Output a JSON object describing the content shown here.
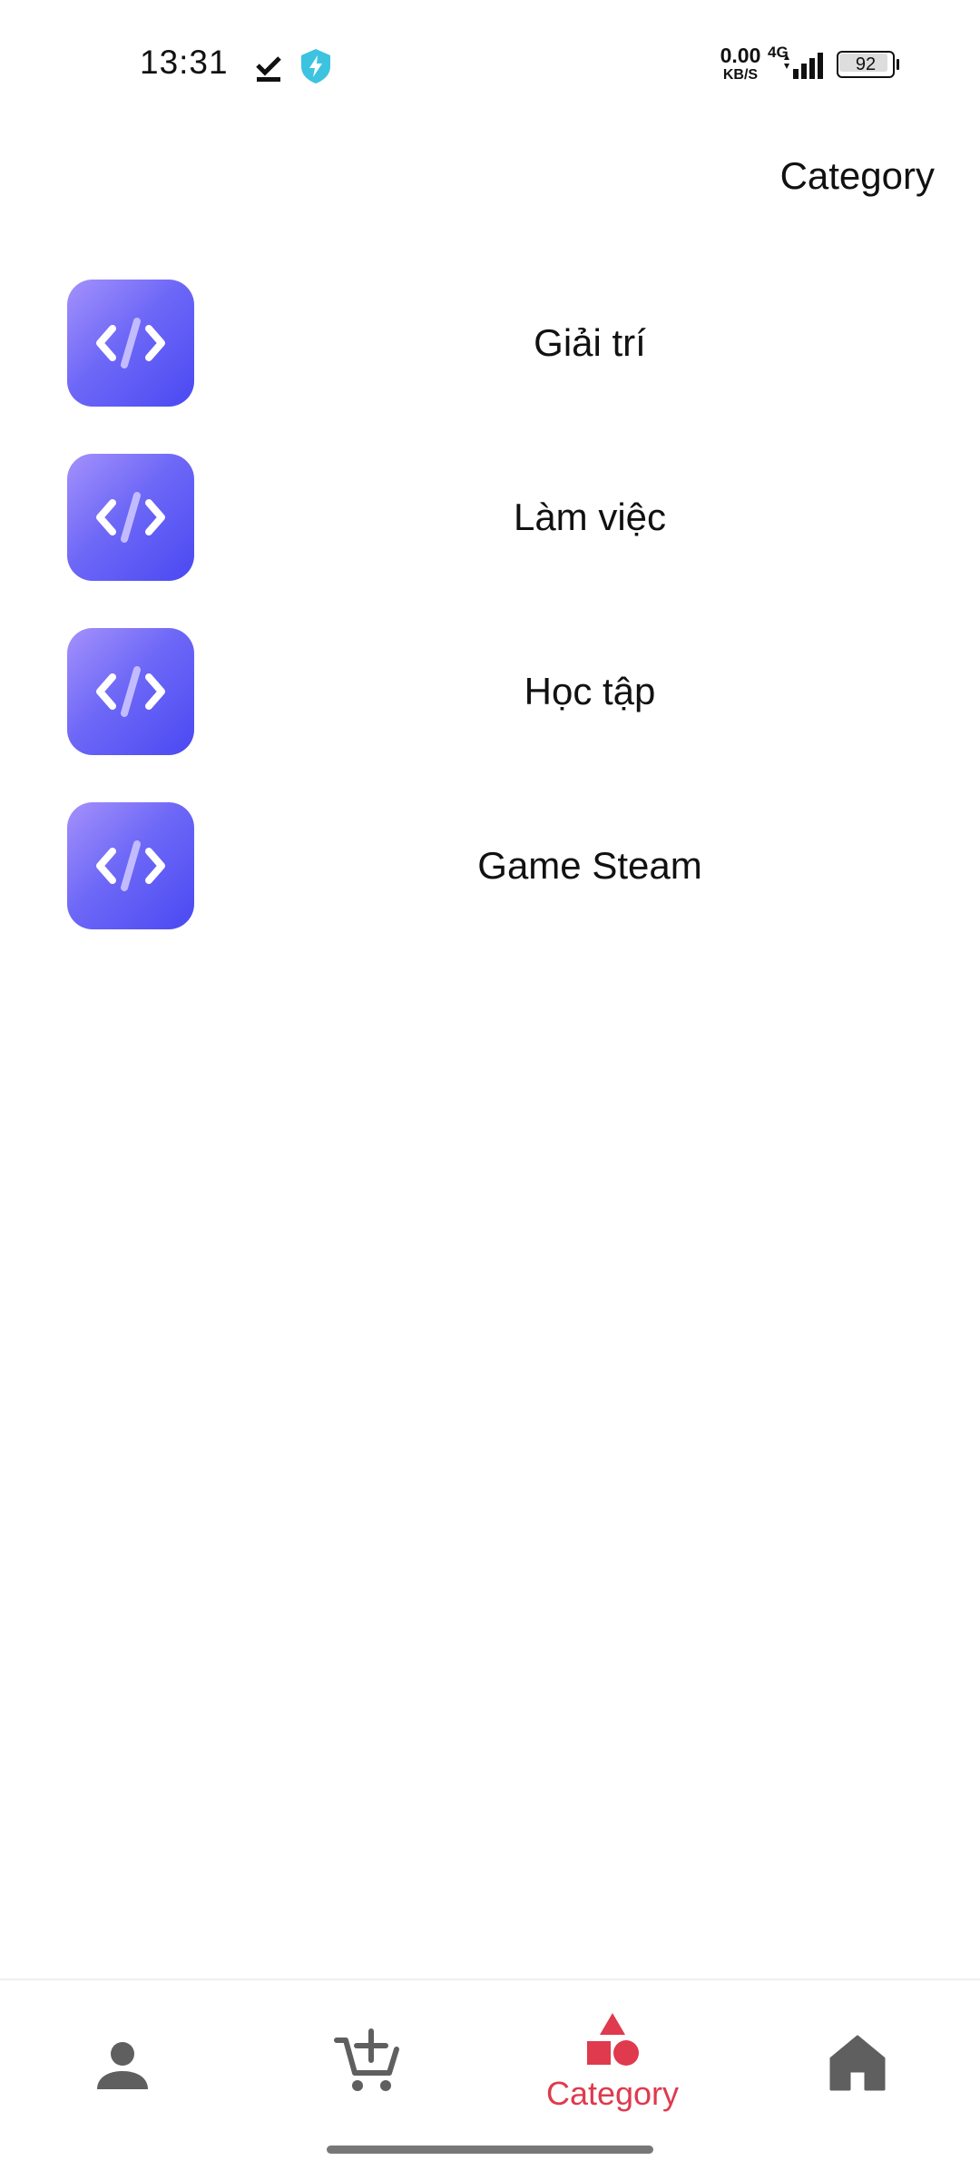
{
  "status_bar": {
    "time": "13:31",
    "net_speed_value": "0.00",
    "net_speed_unit": "KB/S",
    "network_type": "4G",
    "battery_level": 92,
    "battery_text": "92",
    "icons": [
      "download-done-icon",
      "shield-bolt-icon",
      "signal-icon",
      "battery-icon"
    ]
  },
  "header": {
    "title": "Category"
  },
  "categories": [
    {
      "label": "Giải trí",
      "icon": "code-icon"
    },
    {
      "label": "Làm việc",
      "icon": "code-icon"
    },
    {
      "label": "Học tập",
      "icon": "code-icon"
    },
    {
      "label": "Game Steam",
      "icon": "code-icon"
    }
  ],
  "bottom_nav": {
    "items": [
      {
        "name": "profile",
        "icon": "person-icon",
        "label": "",
        "active": false
      },
      {
        "name": "cart",
        "icon": "add-cart-icon",
        "label": "",
        "active": false
      },
      {
        "name": "category",
        "icon": "shapes-icon",
        "label": "Category",
        "active": true
      },
      {
        "name": "home",
        "icon": "home-icon",
        "label": "",
        "active": false
      }
    ]
  },
  "colors": {
    "accent": "#df3a4d",
    "icon_gradient_start": "#a491fb",
    "icon_gradient_end": "#4a49f2",
    "nav_inactive": "#5f5f5f",
    "shield": "#3cc3e0"
  }
}
